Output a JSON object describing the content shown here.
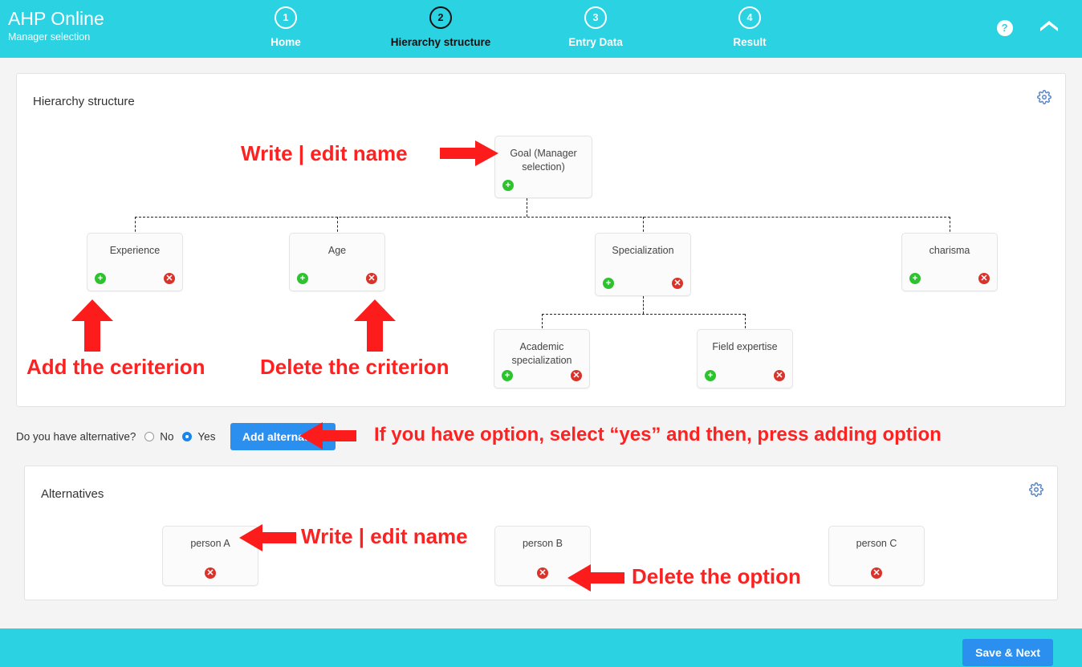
{
  "header": {
    "brand_title": "AHP Online",
    "brand_subtitle": "Manager selection",
    "steps": [
      {
        "number": "1",
        "label": "Home",
        "active": false
      },
      {
        "number": "2",
        "label": "Hierarchy structure",
        "active": true
      },
      {
        "number": "3",
        "label": "Entry Data",
        "active": false
      },
      {
        "number": "4",
        "label": "Result",
        "active": false
      }
    ],
    "help_glyph": "?",
    "icons": {
      "help": "help-icon",
      "home": "home-icon"
    },
    "background_color": "#2ad2e2"
  },
  "hierarchy": {
    "title": "Hierarchy structure",
    "goal": {
      "label": "Goal (Manager selection)"
    },
    "criteria": [
      {
        "label": "Experience"
      },
      {
        "label": "Age"
      },
      {
        "label": "Specialization"
      },
      {
        "label": "charisma"
      }
    ],
    "subcriteria": [
      {
        "label": "Academic specialization",
        "parent": "Specialization"
      },
      {
        "label": "Field expertise",
        "parent": "Specialization"
      }
    ],
    "add_glyph": "+",
    "delete_glyph": "✕"
  },
  "alternatives_control": {
    "question": "Do you have alternative?",
    "option_no": "No",
    "option_yes": "Yes",
    "selected": "Yes",
    "add_button": "Add alternative"
  },
  "alternatives": {
    "title": "Alternatives",
    "items": [
      {
        "label": "person A"
      },
      {
        "label": "person B"
      },
      {
        "label": "person C"
      }
    ]
  },
  "annotations": {
    "goal_name": "Write | edit name",
    "add_criterion": "Add the ceriterion",
    "delete_criterion": "Delete the criterion",
    "alternative_hint": "If you have option, select “yes” and then, press adding option",
    "alternative_name": "Write | edit name",
    "delete_option": "Delete the option",
    "color": "#fd2222"
  },
  "footer": {
    "save_next": "Save & Next",
    "background_color": "#2ad2e2",
    "button_color": "#2a8fef"
  }
}
